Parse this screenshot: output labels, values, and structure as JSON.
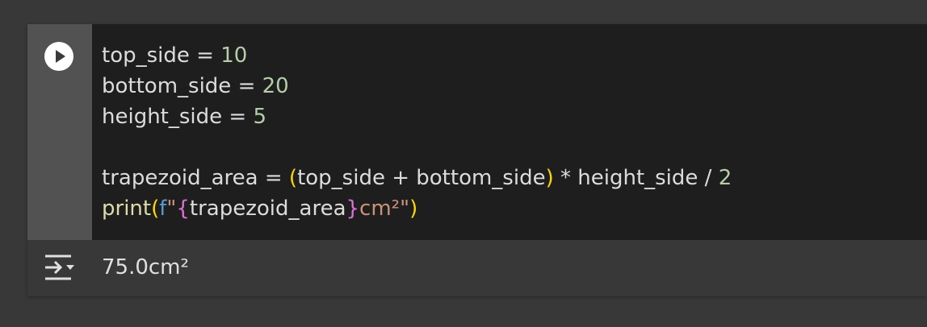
{
  "cell": {
    "run_button_label": "Run cell",
    "code_lines": [
      {
        "var": "top_side",
        "op": " = ",
        "value": "10"
      },
      {
        "var": "bottom_side",
        "op": " = ",
        "value": "20"
      },
      {
        "var": "height_side",
        "op": " = ",
        "value": "5"
      },
      {
        "area_var": "trapezoid_area",
        "op": " = ",
        "open": "(",
        "a": "top_side",
        "plus": " + ",
        "b": "bottom_side",
        "close": ")",
        "times": " * ",
        "c": "height_side",
        "div": " / ",
        "d": "2"
      },
      {
        "func": "print",
        "open": "(",
        "prefix": "f",
        "quote_open": "\"",
        "brace_open": "{",
        "inner": "trapezoid_area",
        "brace_close": "}",
        "suffix": "cm²",
        "quote_close": "\"",
        "close": ")"
      }
    ]
  },
  "output": {
    "icon": "output-settings-icon",
    "text": "75.0cm²"
  },
  "colors": {
    "number": "#b5cea8",
    "bracket": "#ffd700",
    "function": "#dcdcaa",
    "fstring_prefix": "#569cd6",
    "string": "#ce9178",
    "brace": "#da70d6"
  }
}
